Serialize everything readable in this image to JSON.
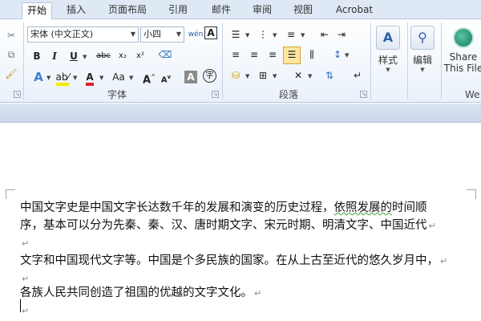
{
  "tabs": [
    "开始",
    "插入",
    "页面布局",
    "引用",
    "邮件",
    "审阅",
    "视图",
    "Acrobat"
  ],
  "active_tab": "开始",
  "font_group": {
    "font_name": "宋体 (中文正文)",
    "font_size": "小四",
    "label": "字体"
  },
  "paragraph_group": {
    "label": "段落"
  },
  "styles": {
    "label": "样式"
  },
  "editing": {
    "label": "编辑"
  },
  "share": {
    "line1": "Share",
    "line2": "This File",
    "cut_off": "We"
  },
  "font_buttons": {
    "bold": "B",
    "italic": "I",
    "underline": "U",
    "strike": "abc",
    "subscript": "x₂",
    "superscript": "x²",
    "grow": "A",
    "shrink": "A",
    "case": "Aa",
    "char_border": "A",
    "enclose": "字",
    "phonetic": "wén"
  },
  "document": {
    "lines": [
      {
        "text": "中国文字史是中国文字长达数千年的发展和演变的历史过程，",
        "squiggle": "依照发展的",
        "tail": "时间顺"
      },
      {
        "text": "序，基本可以分为先秦、秦、汉、唐时期文字、宋元时期、明清文字、中国近代",
        "mark": "↵"
      },
      {
        "text": "",
        "mark": "↵"
      },
      {
        "text": "文字和中国现代文字等。中国是个多民族的国家。在从上古至近代的悠久岁月中，",
        "mark": "↵"
      },
      {
        "text": "",
        "mark": "↵"
      },
      {
        "text": "各族人民共同创造了祖国的优越的文字文化。",
        "mark": "↵"
      },
      {
        "text": "",
        "mark": "↵"
      }
    ]
  }
}
